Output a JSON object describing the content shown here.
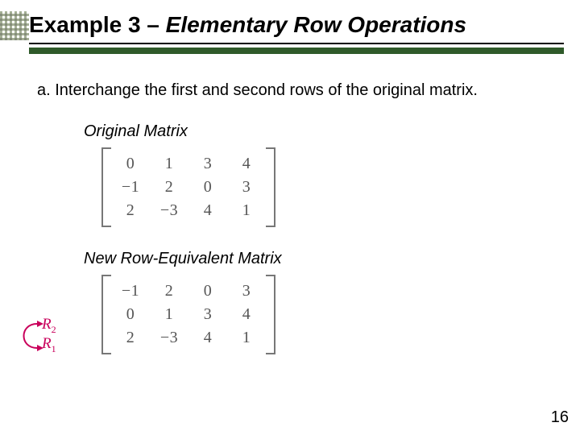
{
  "title": {
    "example_prefix": "Example 3 – ",
    "example_name": "Elementary Row Operations"
  },
  "body": {
    "item_label": "a.",
    "item_text": "Interchange the first and second rows of the original matrix."
  },
  "sections": {
    "original_label": "Original Matrix",
    "new_label": "New Row-Equivalent Matrix"
  },
  "matrices": {
    "original": [
      [
        "0",
        "1",
        "3",
        "4"
      ],
      [
        "−1",
        "2",
        "0",
        "3"
      ],
      [
        "2",
        "−3",
        "4",
        "1"
      ]
    ],
    "new": [
      [
        "−1",
        "2",
        "0",
        "3"
      ],
      [
        "0",
        "1",
        "3",
        "4"
      ],
      [
        "2",
        "−3",
        "4",
        "1"
      ]
    ]
  },
  "swap_labels": {
    "r_top": "R",
    "r_top_sub": "2",
    "r_bot": "R",
    "r_bot_sub": "1"
  },
  "colors": {
    "accent_green": "#2f5a2a",
    "swap_pink": "#c9005b"
  },
  "page_number": "16"
}
